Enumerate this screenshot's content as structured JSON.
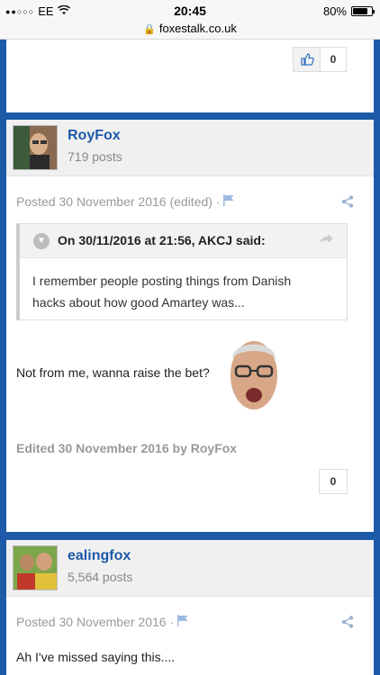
{
  "status_bar": {
    "carrier": "EE",
    "time": "20:45",
    "battery_percent": "80%",
    "battery_level": 0.8
  },
  "browser": {
    "url": "foxestalk.co.uk"
  },
  "prev_post": {
    "reaction_count": "0"
  },
  "posts": [
    {
      "author": "RoyFox",
      "post_count": "719 posts",
      "posted": "Posted 30 November 2016 (edited) ·",
      "quote": {
        "cite": "On 30/11/2016 at 21:56, AKCJ said:",
        "text_line1": "I remember people posting things from Danish",
        "text_line2": "hacks about how good Amartey was..."
      },
      "body": "Not from me, wanna raise the bet?",
      "edited": "Edited 30 November 2016 by RoyFox",
      "reaction_count": "0"
    },
    {
      "author": "ealingfox",
      "post_count": "5,564 posts",
      "posted": "Posted 30 November 2016 ·",
      "body": "Ah I've missed saying this...."
    }
  ],
  "colors": {
    "brand_blue": "#1d5aa8",
    "meta_gray": "#999999"
  },
  "icons": [
    "wifi-icon",
    "lock-icon",
    "thumbs-up-icon",
    "flag-icon",
    "share-icon",
    "chevron-down-icon",
    "reply-arrow-icon"
  ]
}
